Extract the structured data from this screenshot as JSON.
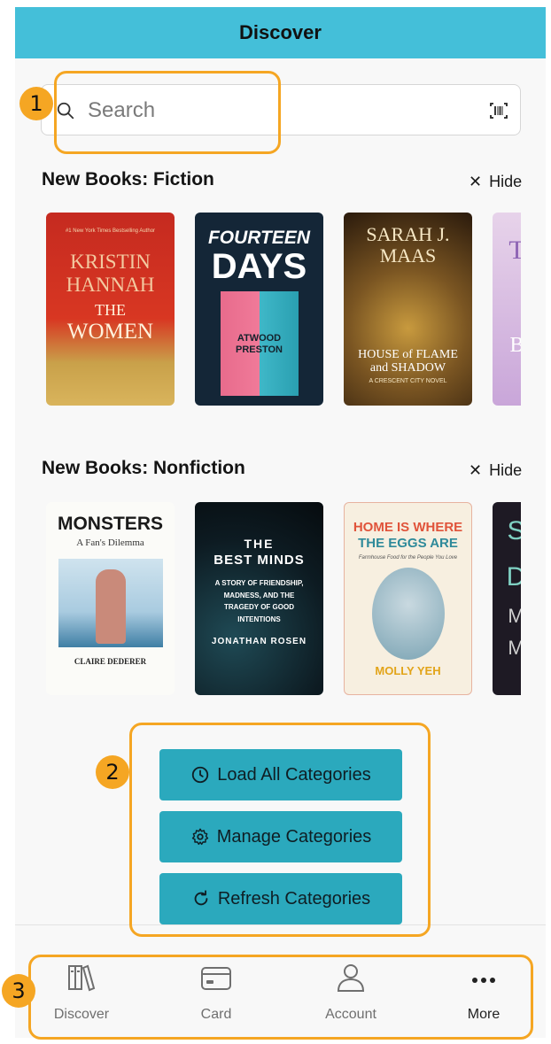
{
  "header": {
    "title": "Discover"
  },
  "search": {
    "placeholder": "Search"
  },
  "sections": [
    {
      "title": "New Books: Fiction",
      "hide_label": "Hide",
      "books": [
        {
          "lines": [
            "KRISTIN",
            "HANNAH",
            "THE",
            "WOMEN"
          ],
          "tagline": "#1 New York Times Bestselling Author"
        },
        {
          "lines": [
            "FOURTEEN",
            "DAYS",
            "ATWOOD",
            "PRESTON"
          ]
        },
        {
          "lines": [
            "SARAH J.",
            "MAAS",
            "HOUSE of FLAME",
            "and SHADOW"
          ],
          "tagline": "A CRESCENT CITY NOVEL"
        },
        {
          "lines": [
            "T",
            "B"
          ]
        }
      ]
    },
    {
      "title": "New Books: Nonfiction",
      "hide_label": "Hide",
      "books": [
        {
          "lines": [
            "MONSTERS",
            "A Fan's Dilemma",
            "CLAIRE DEDERER"
          ]
        },
        {
          "lines": [
            "THE",
            "BEST MINDS",
            "A STORY OF FRIENDSHIP, MADNESS, AND THE TRAGEDY OF GOOD INTENTIONS",
            "JONATHAN ROSEN"
          ]
        },
        {
          "lines": [
            "HOME IS WHERE",
            "THE EGGS ARE",
            "Farmhouse Food for the People You Love",
            "MOLLY YEH"
          ]
        },
        {
          "lines": [
            "S",
            "D",
            "M",
            "M"
          ]
        }
      ]
    }
  ],
  "buttons": {
    "load_all": "Load All Categories",
    "manage": "Manage Categories",
    "refresh": "Refresh Categories"
  },
  "tabs": [
    {
      "label": "Discover",
      "icon": "books-icon"
    },
    {
      "label": "Card",
      "icon": "card-icon"
    },
    {
      "label": "Account",
      "icon": "person-icon"
    },
    {
      "label": "More",
      "icon": "more-icon"
    }
  ],
  "annotations": [
    "1",
    "2",
    "3"
  ],
  "colors": {
    "header": "#44bfd9",
    "button": "#2ba9bd",
    "annotation": "#f5a623"
  }
}
